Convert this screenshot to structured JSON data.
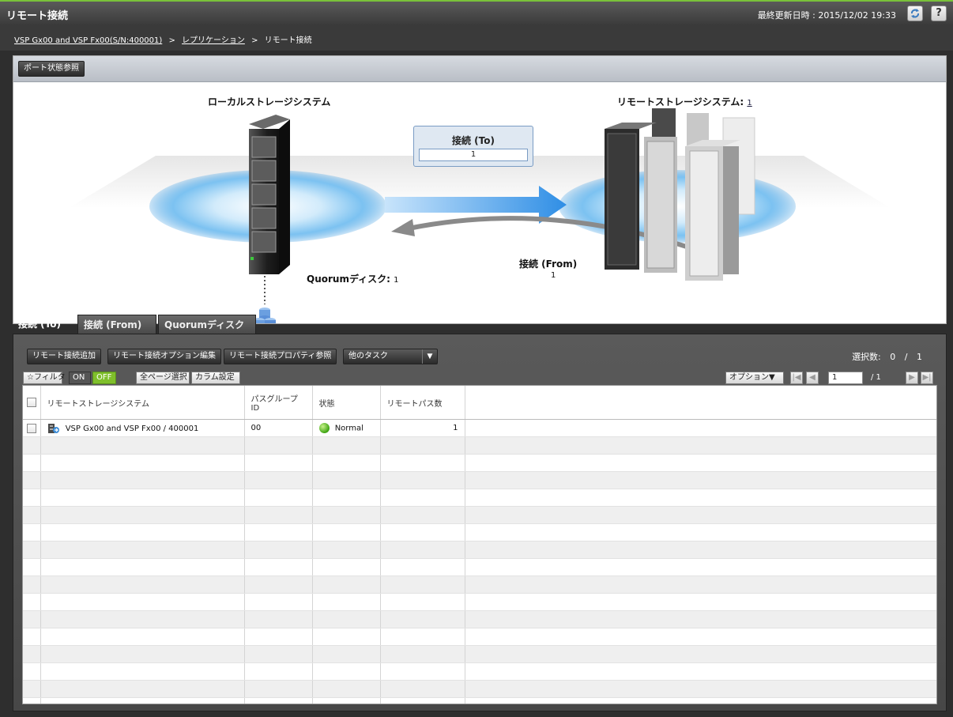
{
  "header": {
    "title": "リモート接続",
    "last_updated_label": "最終更新日時 :",
    "last_updated_value": "2015/12/02 19:33",
    "refresh_icon": "refresh-icon",
    "help_label": "?"
  },
  "breadcrumb": {
    "item1": "VSP Gx00 and VSP Fx00(S/N:400001)",
    "sep": ">",
    "item2": "レプリケーション",
    "item3": "リモート接続"
  },
  "topology": {
    "port_status_button": "ポート状態参照",
    "local_label": "ローカルストレージシステム",
    "remote_label": "リモートストレージシステム:",
    "remote_count": "1",
    "conn_to_label": "接続 (To)",
    "conn_to_value": "1",
    "conn_from_label": "接続 (From)",
    "conn_from_value": "1",
    "quorum_label": "Quorumディスク:",
    "quorum_value": "1"
  },
  "tabs": [
    {
      "label": "接続 (To)",
      "active": true
    },
    {
      "label": "接続 (From)",
      "active": false
    },
    {
      "label": "Quorumディスク",
      "active": false
    }
  ],
  "actions": {
    "add": "リモート接続追加",
    "edit_options": "リモート接続オプション編集",
    "view_properties": "リモート接続プロパティ参照",
    "other_tasks": "他のタスク"
  },
  "selection": {
    "label": "選択数:",
    "selected": "0",
    "slash": "/",
    "total": "1"
  },
  "filterbar": {
    "filter": "☆フィルタ",
    "on": "ON",
    "off": "OFF",
    "select_all_pages": "全ページ選択",
    "column_settings": "カラム設定"
  },
  "pager": {
    "options": "オプション▼",
    "page": "1",
    "total": "/ 1"
  },
  "table": {
    "columns": [
      "リモートストレージシステム",
      "パスグループ ID",
      "状態",
      "リモートパス数"
    ],
    "rows": [
      {
        "system": "VSP Gx00 and VSP Fx00 / 400001",
        "path_group_id": "00",
        "status": "Normal",
        "remote_paths": "1"
      }
    ]
  }
}
